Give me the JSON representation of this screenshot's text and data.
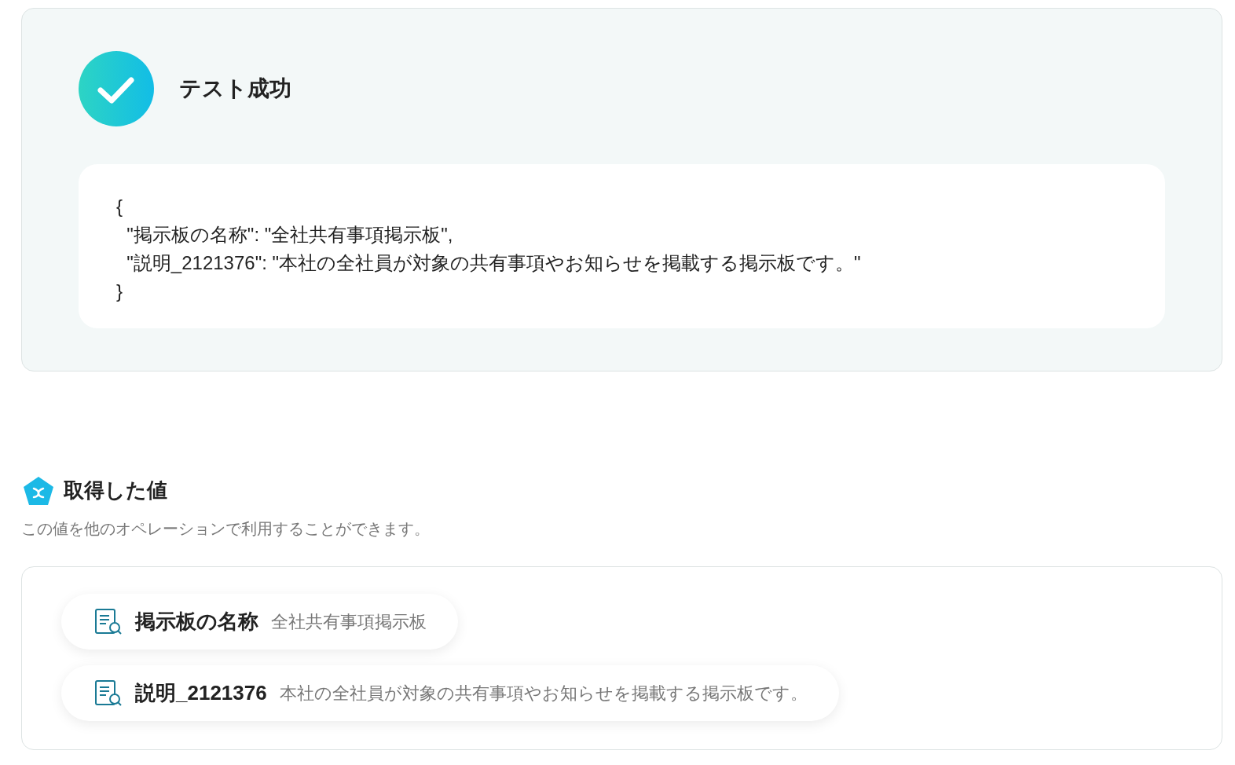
{
  "result": {
    "title": "テスト成功",
    "code_lines": [
      "{",
      "  \"掲示板の名称\": \"全社共有事項掲示板\",",
      "  \"説明_2121376\": \"本社の全社員が対象の共有事項やお知らせを掲載する掲示板です。\"",
      "}"
    ]
  },
  "values": {
    "title": "取得した値",
    "description": "この値を他のオペレーションで利用することができます。",
    "items": [
      {
        "label": "掲示板の名称",
        "value": "全社共有事項掲示板"
      },
      {
        "label": "説明_2121376",
        "value": "本社の全社員が対象の共有事項やお知らせを掲載する掲示板です。"
      }
    ]
  }
}
